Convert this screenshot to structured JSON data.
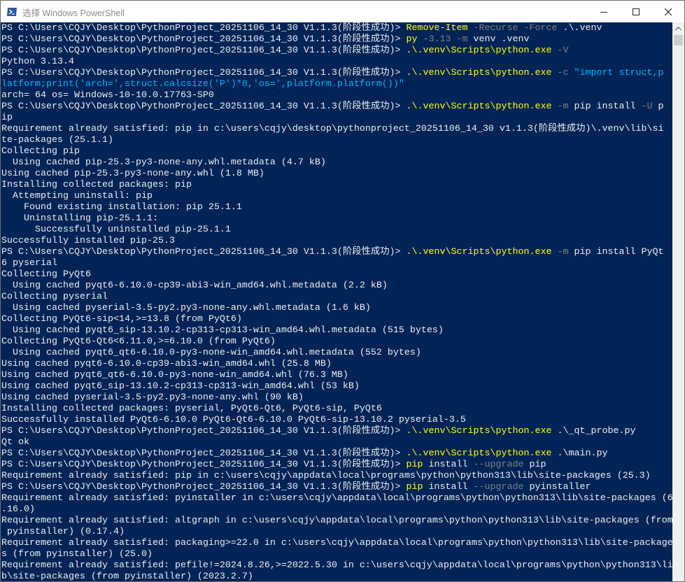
{
  "window": {
    "title": "选择 Windows PowerShell",
    "controls": {
      "minimize": "minimize-icon",
      "maximize": "maximize-icon",
      "close": "close-icon"
    }
  },
  "colors": {
    "background": "#012456",
    "text": "#eeedf0",
    "command": "#ffff00",
    "parameter": "#808080",
    "string": "#00b7ff"
  },
  "terminal": {
    "lines": [
      [
        {
          "t": "PS C:\\Users\\CQJY\\Desktop\\PythonProject_20251106_14_30 V1.1.3(阶段性成功)> "
        },
        {
          "t": "Remove-Item",
          "k": "cmd"
        },
        {
          "t": " -Recurse -Force",
          "k": "par"
        },
        {
          "t": " .\\.venv"
        }
      ],
      [
        {
          "t": "PS C:\\Users\\CQJY\\Desktop\\PythonProject_20251106_14_30 V1.1.3(阶段性成功)> "
        },
        {
          "t": "py",
          "k": "cmd"
        },
        {
          "t": " -3.13 -m",
          "k": "par"
        },
        {
          "t": " venv .venv"
        }
      ],
      [
        {
          "t": "PS C:\\Users\\CQJY\\Desktop\\PythonProject_20251106_14_30 V1.1.3(阶段性成功)> "
        },
        {
          "t": ".\\.venv\\Scripts\\python.exe",
          "k": "cmd"
        },
        {
          "t": " -V",
          "k": "par"
        }
      ],
      [
        {
          "t": "Python 3.13.4"
        }
      ],
      [
        {
          "t": "PS C:\\Users\\CQJY\\Desktop\\PythonProject_20251106_14_30 V1.1.3(阶段性成功)> "
        },
        {
          "t": ".\\.venv\\Scripts\\python.exe",
          "k": "cmd"
        },
        {
          "t": " -c",
          "k": "par"
        },
        {
          "t": " \"import struct,p",
          "k": "str"
        }
      ],
      [
        {
          "t": "latform;print('arch=',struct.calcsize('P')*8,'os=',platform.platform())\"",
          "k": "str"
        }
      ],
      [
        {
          "t": "arch= 64 os= Windows-10-10.0.17763-SP0"
        }
      ],
      [
        {
          "t": "PS C:\\Users\\CQJY\\Desktop\\PythonProject_20251106_14_30 V1.1.3(阶段性成功)> "
        },
        {
          "t": ".\\.venv\\Scripts\\python.exe",
          "k": "cmd"
        },
        {
          "t": " -m",
          "k": "par"
        },
        {
          "t": " pip install"
        },
        {
          "t": " -U",
          "k": "par"
        },
        {
          "t": " p"
        }
      ],
      [
        {
          "t": "ip"
        }
      ],
      [
        {
          "t": "Requirement already satisfied: pip in c:\\users\\cqjy\\desktop\\pythonproject_20251106_14_30 v1.1.3(阶段性成功)\\.venv\\lib\\si"
        }
      ],
      [
        {
          "t": "te-packages (25.1.1)"
        }
      ],
      [
        {
          "t": "Collecting pip"
        }
      ],
      [
        {
          "t": "  Using cached pip-25.3-py3-none-any.whl.metadata (4.7 kB)"
        }
      ],
      [
        {
          "t": "Using cached pip-25.3-py3-none-any.whl (1.8 MB)"
        }
      ],
      [
        {
          "t": "Installing collected packages: pip"
        }
      ],
      [
        {
          "t": "  Attempting uninstall: pip"
        }
      ],
      [
        {
          "t": "    Found existing installation: pip 25.1.1"
        }
      ],
      [
        {
          "t": "    Uninstalling pip-25.1.1:"
        }
      ],
      [
        {
          "t": "      Successfully uninstalled pip-25.1.1"
        }
      ],
      [
        {
          "t": "Successfully installed pip-25.3"
        }
      ],
      [
        {
          "t": "PS C:\\Users\\CQJY\\Desktop\\PythonProject_20251106_14_30 V1.1.3(阶段性成功)> "
        },
        {
          "t": ".\\.venv\\Scripts\\python.exe",
          "k": "cmd"
        },
        {
          "t": " -m",
          "k": "par"
        },
        {
          "t": " pip install PyQt"
        }
      ],
      [
        {
          "t": "6 pyserial"
        }
      ],
      [
        {
          "t": "Collecting PyQt6"
        }
      ],
      [
        {
          "t": "  Using cached pyqt6-6.10.0-cp39-abi3-win_amd64.whl.metadata (2.2 kB)"
        }
      ],
      [
        {
          "t": "Collecting pyserial"
        }
      ],
      [
        {
          "t": "  Using cached pyserial-3.5-py2.py3-none-any.whl.metadata (1.6 kB)"
        }
      ],
      [
        {
          "t": "Collecting PyQt6-sip<14,>=13.8 (from PyQt6)"
        }
      ],
      [
        {
          "t": "  Using cached pyqt6_sip-13.10.2-cp313-cp313-win_amd64.whl.metadata (515 bytes)"
        }
      ],
      [
        {
          "t": "Collecting PyQt6-Qt6<6.11.0,>=6.10.0 (from PyQt6)"
        }
      ],
      [
        {
          "t": "  Using cached pyqt6_qt6-6.10.0-py3-none-win_amd64.whl.metadata (552 bytes)"
        }
      ],
      [
        {
          "t": "Using cached pyqt6-6.10.0-cp39-abi3-win_amd64.whl (25.8 MB)"
        }
      ],
      [
        {
          "t": "Using cached pyqt6_qt6-6.10.0-py3-none-win_amd64.whl (76.3 MB)"
        }
      ],
      [
        {
          "t": "Using cached pyqt6_sip-13.10.2-cp313-cp313-win_amd64.whl (53 kB)"
        }
      ],
      [
        {
          "t": "Using cached pyserial-3.5-py2.py3-none-any.whl (90 kB)"
        }
      ],
      [
        {
          "t": "Installing collected packages: pyserial, PyQt6-Qt6, PyQt6-sip, PyQt6"
        }
      ],
      [
        {
          "t": "Successfully installed PyQt6-6.10.0 PyQt6-Qt6-6.10.0 PyQt6-sip-13.10.2 pyserial-3.5"
        }
      ],
      [
        {
          "t": "PS C:\\Users\\CQJY\\Desktop\\PythonProject_20251106_14_30 V1.1.3(阶段性成功)> "
        },
        {
          "t": ".\\.venv\\Scripts\\python.exe",
          "k": "cmd"
        },
        {
          "t": " .\\_qt_probe.py"
        }
      ],
      [
        {
          "t": "Qt ok"
        }
      ],
      [
        {
          "t": "PS C:\\Users\\CQJY\\Desktop\\PythonProject_20251106_14_30 V1.1.3(阶段性成功)> "
        },
        {
          "t": ".\\.venv\\Scripts\\python.exe",
          "k": "cmd"
        },
        {
          "t": " .\\main.py"
        }
      ],
      [
        {
          "t": "PS C:\\Users\\CQJY\\Desktop\\PythonProject_20251106_14_30 V1.1.3(阶段性成功)> "
        },
        {
          "t": "pip",
          "k": "cmd"
        },
        {
          "t": " install"
        },
        {
          "t": " --upgrade",
          "k": "par"
        },
        {
          "t": " pip"
        }
      ],
      [
        {
          "t": "Requirement already satisfied: pip in c:\\users\\cqjy\\appdata\\local\\programs\\python\\python313\\lib\\site-packages (25.3)"
        }
      ],
      [
        {
          "t": "PS C:\\Users\\CQJY\\Desktop\\PythonProject_20251106_14_30 V1.1.3(阶段性成功)> "
        },
        {
          "t": "pip",
          "k": "cmd"
        },
        {
          "t": " install"
        },
        {
          "t": " --upgrade",
          "k": "par"
        },
        {
          "t": " pyinstaller"
        }
      ],
      [
        {
          "t": "Requirement already satisfied: pyinstaller in c:\\users\\cqjy\\appdata\\local\\programs\\python\\python313\\lib\\site-packages (6"
        }
      ],
      [
        {
          "t": ".16.0)"
        }
      ],
      [
        {
          "t": "Requirement already satisfied: altgraph in c:\\users\\cqjy\\appdata\\local\\programs\\python\\python313\\lib\\site-packages (from"
        }
      ],
      [
        {
          "t": " pyinstaller) (0.17.4)"
        }
      ],
      [
        {
          "t": "Requirement already satisfied: packaging>=22.0 in c:\\users\\cqjy\\appdata\\local\\programs\\python\\python313\\lib\\site-package"
        }
      ],
      [
        {
          "t": "s (from pyinstaller) (25.0)"
        }
      ],
      [
        {
          "t": "Requirement already satisfied: pefile!=2024.8.26,>=2022.5.30 in c:\\users\\cqjy\\appdata\\local\\programs\\python\\python313\\li"
        }
      ],
      [
        {
          "t": "b\\site-packages (from pyinstaller) (2023.2.7)"
        }
      ]
    ]
  },
  "scrollbar": {
    "up_arrow": "scroll-up-arrow-icon"
  }
}
